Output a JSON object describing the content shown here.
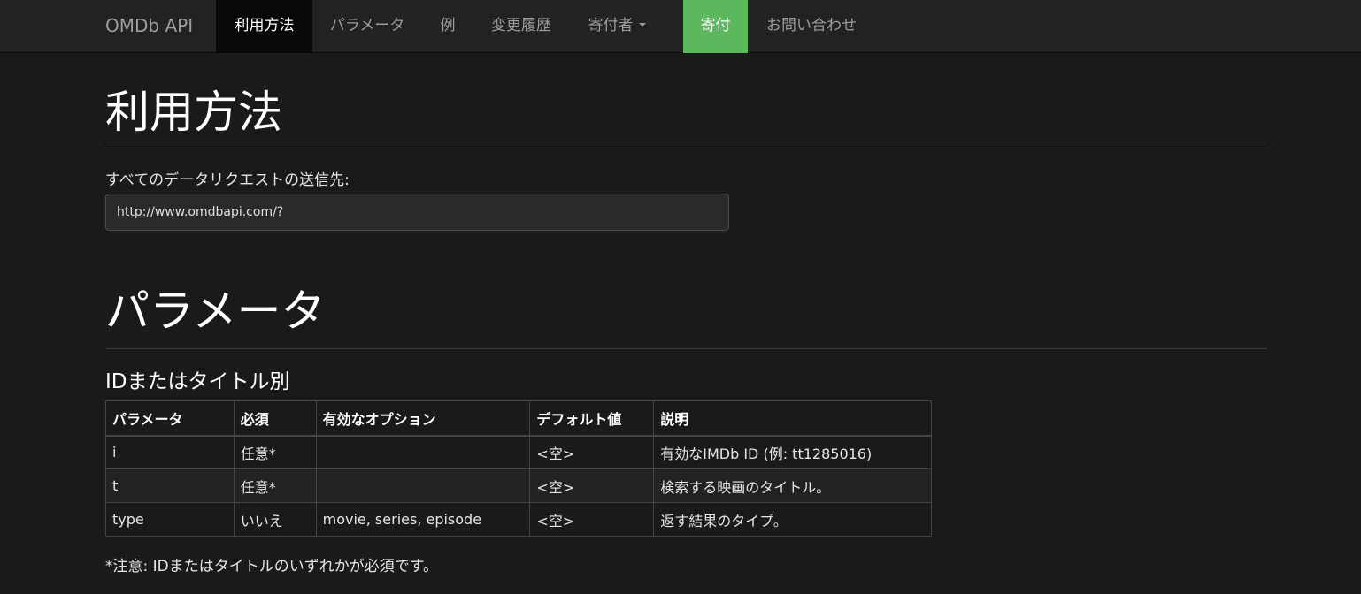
{
  "navbar": {
    "brand": "OMDb API",
    "items": [
      {
        "label": "利用方法"
      },
      {
        "label": "パラメータ"
      },
      {
        "label": "例"
      },
      {
        "label": "変更履歴"
      },
      {
        "label": "寄付者"
      },
      {
        "label": "寄付"
      },
      {
        "label": "お問い合わせ"
      }
    ]
  },
  "usage": {
    "heading": "利用方法",
    "endpoint_label": "すべてのデータリクエストの送信先:",
    "endpoint_value": "http://www.omdbapi.com/?"
  },
  "parameters": {
    "heading": "パラメータ",
    "subheading": "IDまたはタイトル別",
    "table": {
      "headers": [
        "パラメータ",
        "必須",
        "有効なオプション",
        "デフォルト値",
        "説明"
      ],
      "rows": [
        [
          "i",
          "任意*",
          "",
          "<空>",
          "有効なIMDb ID (例: tt1285016)"
        ],
        [
          "t",
          "任意*",
          "",
          "<空>",
          "検索する映画のタイトル。"
        ],
        [
          "type",
          "いいえ",
          "movie, series, episode",
          "<空>",
          "返す結果のタイプ。"
        ]
      ]
    },
    "note": "*注意: IDまたはタイトルのいずれかが必須です。"
  },
  "colors": {
    "navbar_bg": "#222222",
    "active_bg": "#080808",
    "donate_bg": "#5cb85c",
    "page_bg": "#1a1a1a"
  }
}
